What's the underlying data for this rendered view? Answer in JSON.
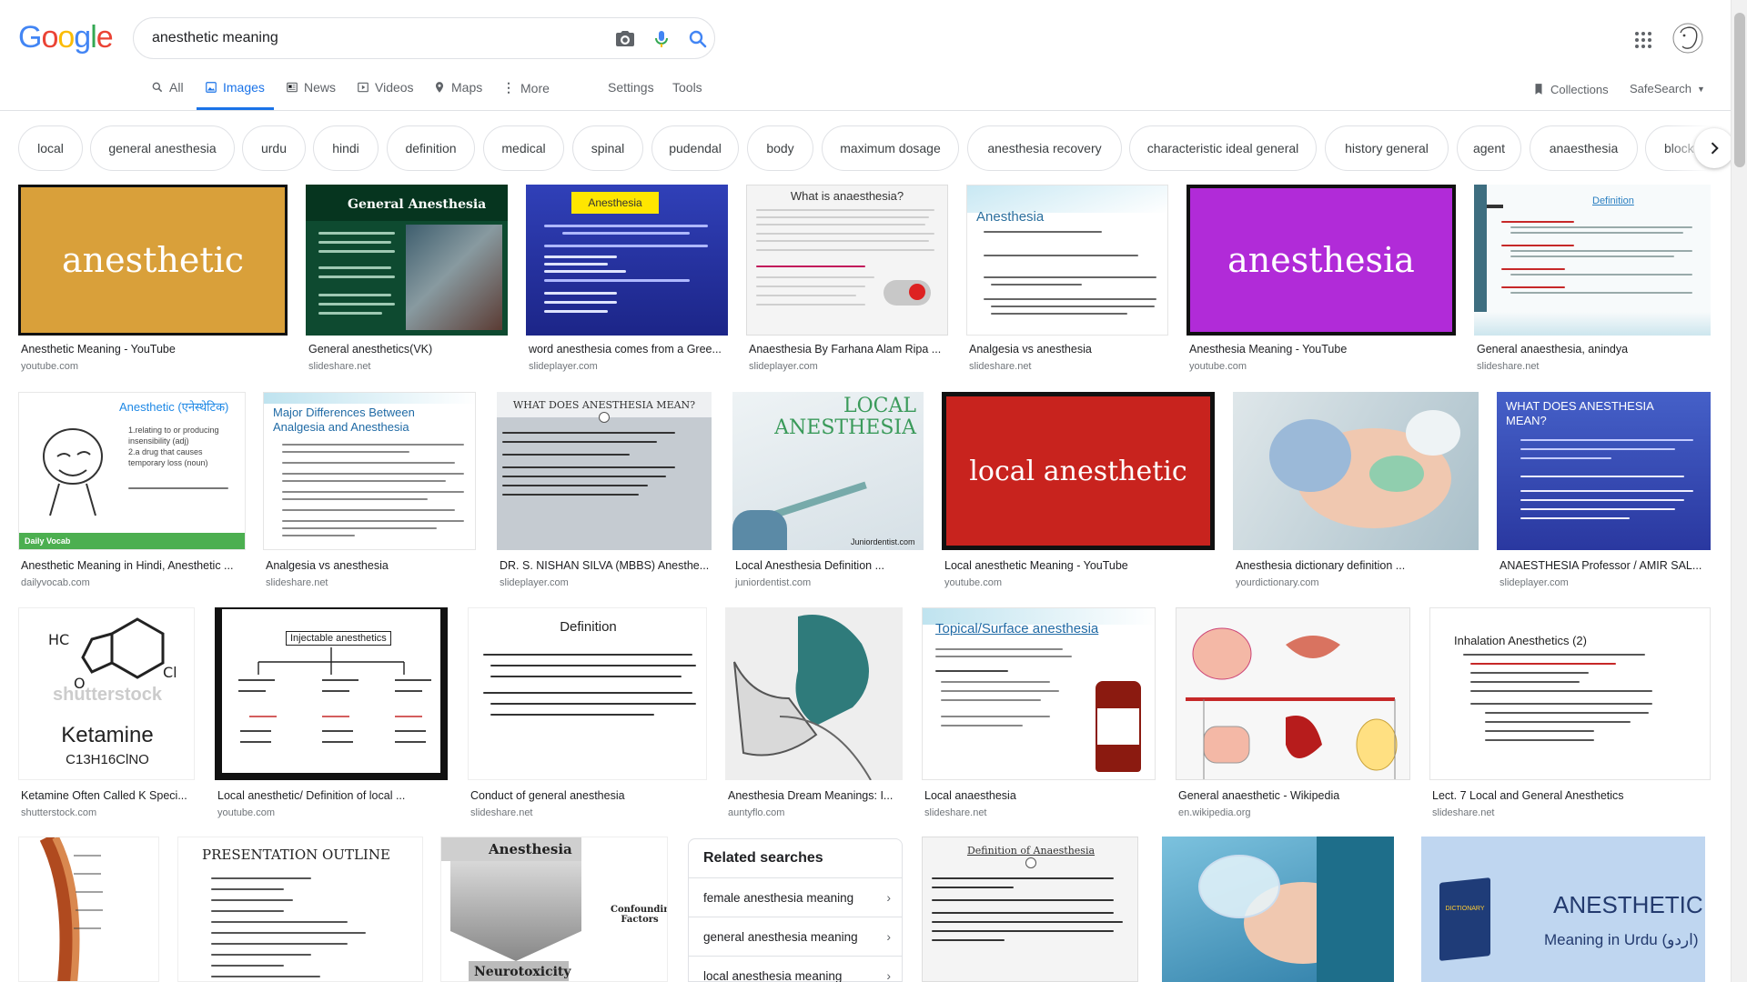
{
  "search": {
    "query": "anesthetic meaning"
  },
  "logo": "Google",
  "tabs": [
    {
      "label": "All"
    },
    {
      "label": "Images"
    },
    {
      "label": "News"
    },
    {
      "label": "Videos"
    },
    {
      "label": "Maps"
    },
    {
      "label": "More"
    }
  ],
  "settings_label": "Settings",
  "tools_label": "Tools",
  "collections_label": "Collections",
  "safesearch_label": "SafeSearch",
  "chips": [
    "local",
    "general anesthesia",
    "urdu",
    "hindi",
    "definition",
    "medical",
    "spinal",
    "pudendal",
    "body",
    "maximum dosage",
    "anesthesia recovery",
    "characteristic ideal general",
    "history general",
    "agent",
    "anaesthesia",
    "block"
  ],
  "results": [
    {
      "caption": "Anesthetic Meaning - YouTube",
      "source": "youtube.com",
      "thumb_text": "anesthetic",
      "bg": "#d9a03a"
    },
    {
      "caption": "General anesthetics(VK)",
      "source": "slideshare.net",
      "thumb_text": "General Anesthesia",
      "bg": "#0e4a30"
    },
    {
      "caption": "word anesthesia comes from a Gree...",
      "source": "slideplayer.com",
      "thumb_text": "Anesthesia",
      "bg": "#2530a8"
    },
    {
      "caption": "Anaesthesia By Farhana Alam Ripa ...",
      "source": "slideplayer.com",
      "thumb_text": "What is anaesthesia?",
      "bg": "#f4f4f4"
    },
    {
      "caption": "Analgesia vs anesthesia",
      "source": "slideshare.net",
      "thumb_text": "Anesthesia",
      "bg": "#ffffff"
    },
    {
      "caption": "Anesthesia Meaning - YouTube",
      "source": "youtube.com",
      "thumb_text": "anesthesia",
      "bg": "#b12bd8"
    },
    {
      "caption": "General anaesthesia, anindya",
      "source": "slideshare.net",
      "thumb_text": "Definition",
      "bg": "#f7fafb"
    },
    {
      "caption": "Anesthetic Meaning in Hindi, Anesthetic ...",
      "source": "dailyvocab.com",
      "thumb_text": "Anesthetic (एनेस्थेटिक)",
      "bg": "#ffffff"
    },
    {
      "caption": "Analgesia vs anesthesia",
      "source": "slideshare.net",
      "thumb_text": "Major Differences Between Analgesia and Anesthesia",
      "bg": "#ffffff"
    },
    {
      "caption": "DR. S. NISHAN SILVA (MBBS) Anesthe...",
      "source": "slideplayer.com",
      "thumb_text": "WHAT DOES ANESTHESIA MEAN?",
      "bg": "#c5cbd1"
    },
    {
      "caption": "Local Anesthesia Definition ...",
      "source": "juniordentist.com",
      "thumb_text": "LOCAL ANESTHESIA",
      "bg": "#e8eef1"
    },
    {
      "caption": "Local anesthetic Meaning - YouTube",
      "source": "youtube.com",
      "thumb_text": "local anesthetic",
      "bg": "#c8231e"
    },
    {
      "caption": "Anesthesia dictionary definition ...",
      "source": "yourdictionary.com",
      "thumb_text": "",
      "bg": "#cbd6dd"
    },
    {
      "caption": "ANAESTHESIA Professor / AMIR SAL...",
      "source": "slideplayer.com",
      "thumb_text": "WHAT DOES ANESTHESIA MEAN?",
      "bg": "#3548b0"
    },
    {
      "caption": "Ketamine Often Called K Speci...",
      "source": "shutterstock.com",
      "thumb_text": "Ketamine",
      "bg": "#ffffff"
    },
    {
      "caption": "Local anesthetic/ Definition of local ...",
      "source": "youtube.com",
      "thumb_text": "Injectable anesthetics",
      "bg": "#111111"
    },
    {
      "caption": "Conduct of general anesthesia",
      "source": "slideshare.net",
      "thumb_text": "Definition",
      "bg": "#ffffff"
    },
    {
      "caption": "Anesthesia Dream Meanings: I...",
      "source": "auntyflo.com",
      "thumb_text": "",
      "bg": "#eeeeee"
    },
    {
      "caption": "Local anaesthesia",
      "source": "slideshare.net",
      "thumb_text": "Topical/Surface anesthesia",
      "bg": "#ffffff"
    },
    {
      "caption": "General anaesthetic - Wikipedia",
      "source": "en.wikipedia.org",
      "thumb_text": "",
      "bg": "#f7f7f7"
    },
    {
      "caption": "Lect. 7 Local and General Anesthetics",
      "source": "slideshare.net",
      "thumb_text": "Inhalation Anesthetics (2)",
      "bg": "#ffffff"
    },
    {
      "caption": "",
      "source": "",
      "thumb_text": "",
      "bg": "#ffffff"
    },
    {
      "caption": "",
      "source": "",
      "thumb_text": "PRESENTATION OUTLINE",
      "bg": "#ffffff"
    },
    {
      "caption": "",
      "source": "",
      "thumb_text": "Anesthesia",
      "bg": "#ffffff"
    },
    {
      "caption": "",
      "source": "",
      "thumb_text": "Definition of Anaesthesia",
      "bg": "#f4f4f4"
    },
    {
      "caption": "",
      "source": "",
      "thumb_text": "",
      "bg": "#5aa7c8"
    },
    {
      "caption": "",
      "source": "",
      "thumb_text": "ANESTHETIC",
      "bg": "#bfd6f0"
    }
  ],
  "thumb_extra": {
    "neuro": "Neurotoxicity",
    "urdu": "Meaning in Urdu (اردو)",
    "dictionary": "DICTIONARY",
    "confounding": "Confounding Factors",
    "shutterstock": "shutterstock",
    "formula": "C13H16ClNO",
    "junior": "Juniordentist.com",
    "daily": "Daily Vocab"
  },
  "related": {
    "title": "Related searches",
    "items": [
      "female anesthesia meaning",
      "general anesthesia meaning",
      "local anesthesia meaning"
    ]
  }
}
